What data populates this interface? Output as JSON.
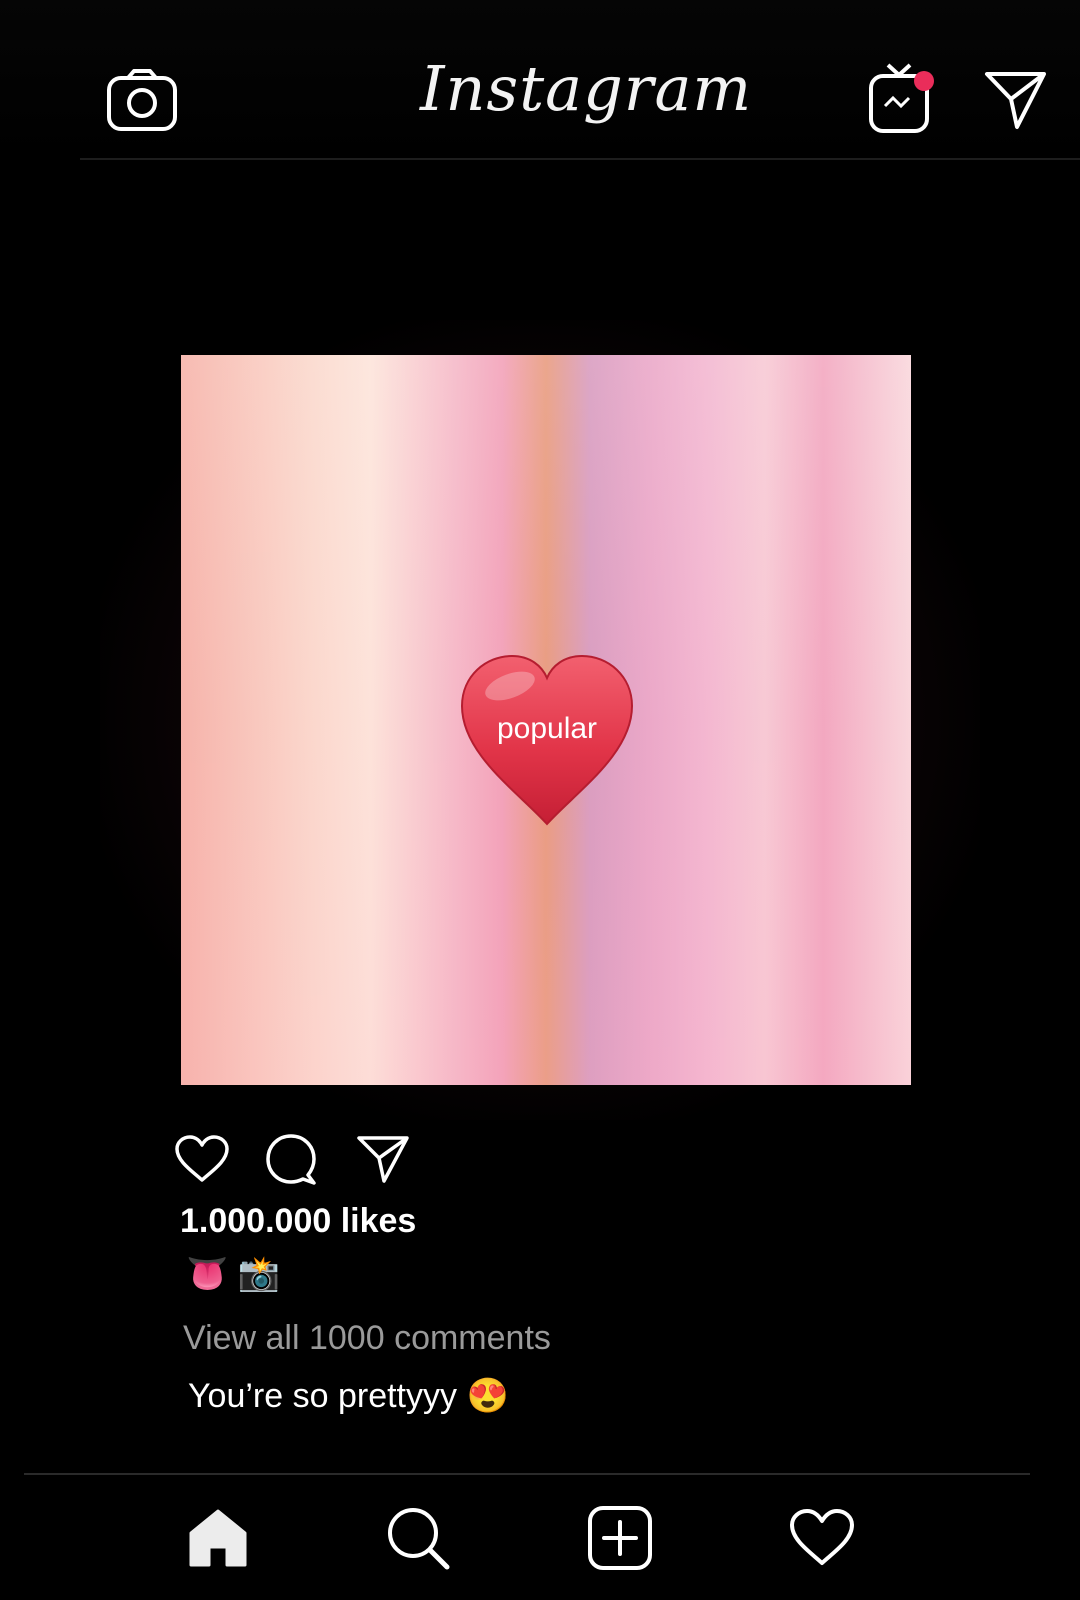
{
  "header": {
    "brand": "Instagram",
    "left_icon": "camera-icon",
    "right_icons": [
      "igtv-icon",
      "direct-message-icon"
    ],
    "notification_color": "#ea2d5a"
  },
  "post": {
    "sticker_label": "popular",
    "sticker_icon": "heart-sticker",
    "actions": [
      "like-icon",
      "comment-icon",
      "share-icon"
    ],
    "likes": "1.000.000 likes",
    "caption": "👅 📸",
    "view_comments": "View all 1000 comments",
    "comment": "You’re so prettyyy 😍"
  },
  "bottom_nav": {
    "items": [
      "home-icon",
      "search-icon",
      "new-post-icon",
      "activity-icon"
    ]
  },
  "colors": {
    "background": "#000000",
    "text": "#ffffff",
    "muted_text": "#9a9a9a",
    "heart": "#e2374a"
  }
}
